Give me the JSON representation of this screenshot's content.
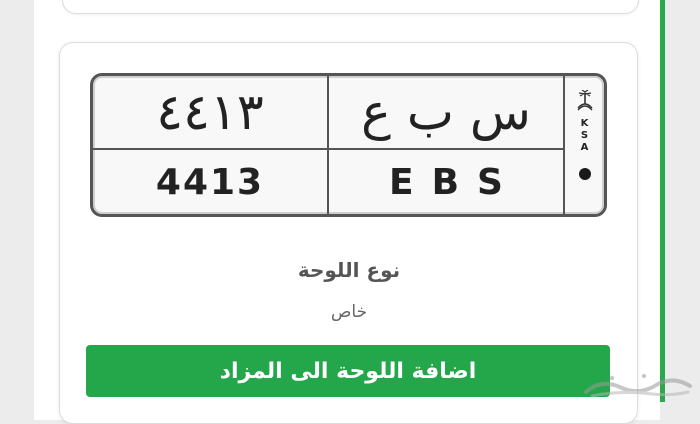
{
  "plate": {
    "arabic_numbers": "٤٤١٣",
    "arabic_letters": "س ب ع",
    "english_numbers": "4413",
    "english_letters": "EBS",
    "country_code": [
      "K",
      "S",
      "A"
    ]
  },
  "details": {
    "type_label": "نوع اللوحة",
    "type_value": "خاص"
  },
  "add_button_label": "اضافة اللوحة الى المزاد",
  "colors": {
    "accent": "#23a74a",
    "plate_border": "#555555"
  },
  "icons": {
    "emblem": "palm-swords-emblem-icon",
    "watermark": "haraj-watermark"
  }
}
